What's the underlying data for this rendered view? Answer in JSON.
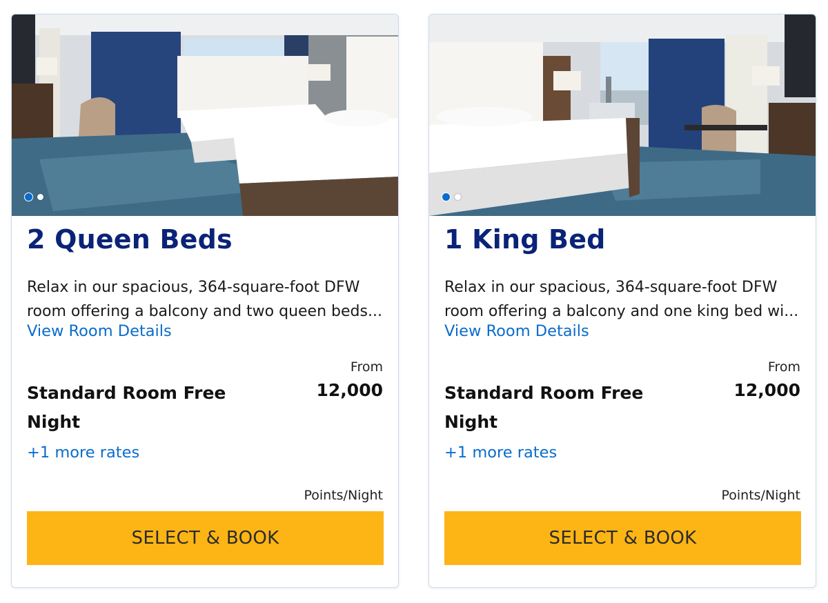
{
  "rooms": [
    {
      "title": "2 Queen Beds",
      "description_line1": "Relax in our spacious, 364-square-foot DFW",
      "description_line2": "room offering a balcony and two queen beds...",
      "details_link": "View Room Details",
      "from_label": "From",
      "rate_name": "Standard Room Free Night",
      "price": "12,000",
      "more_rates": "+1 more rates",
      "unit_label": "Points/Night",
      "book_label": "SELECT & BOOK",
      "carousel": {
        "total": 2,
        "active": 1
      }
    },
    {
      "title": "1 King Bed",
      "description_line1": "Relax in our spacious, 364-square-foot DFW",
      "description_line2": "room offering a balcony and one king bed wi...",
      "details_link": "View Room Details",
      "from_label": "From",
      "rate_name": "Standard Room Free Night",
      "price": "12,000",
      "more_rates": "+1 more rates",
      "unit_label": "Points/Night",
      "book_label": "SELECT & BOOK",
      "carousel": {
        "total": 2,
        "active": 1
      }
    }
  ],
  "colors": {
    "title": "#0b2377",
    "link": "#0a6ccc",
    "button": "#fdb515",
    "card_border": "#cfdbe8"
  }
}
